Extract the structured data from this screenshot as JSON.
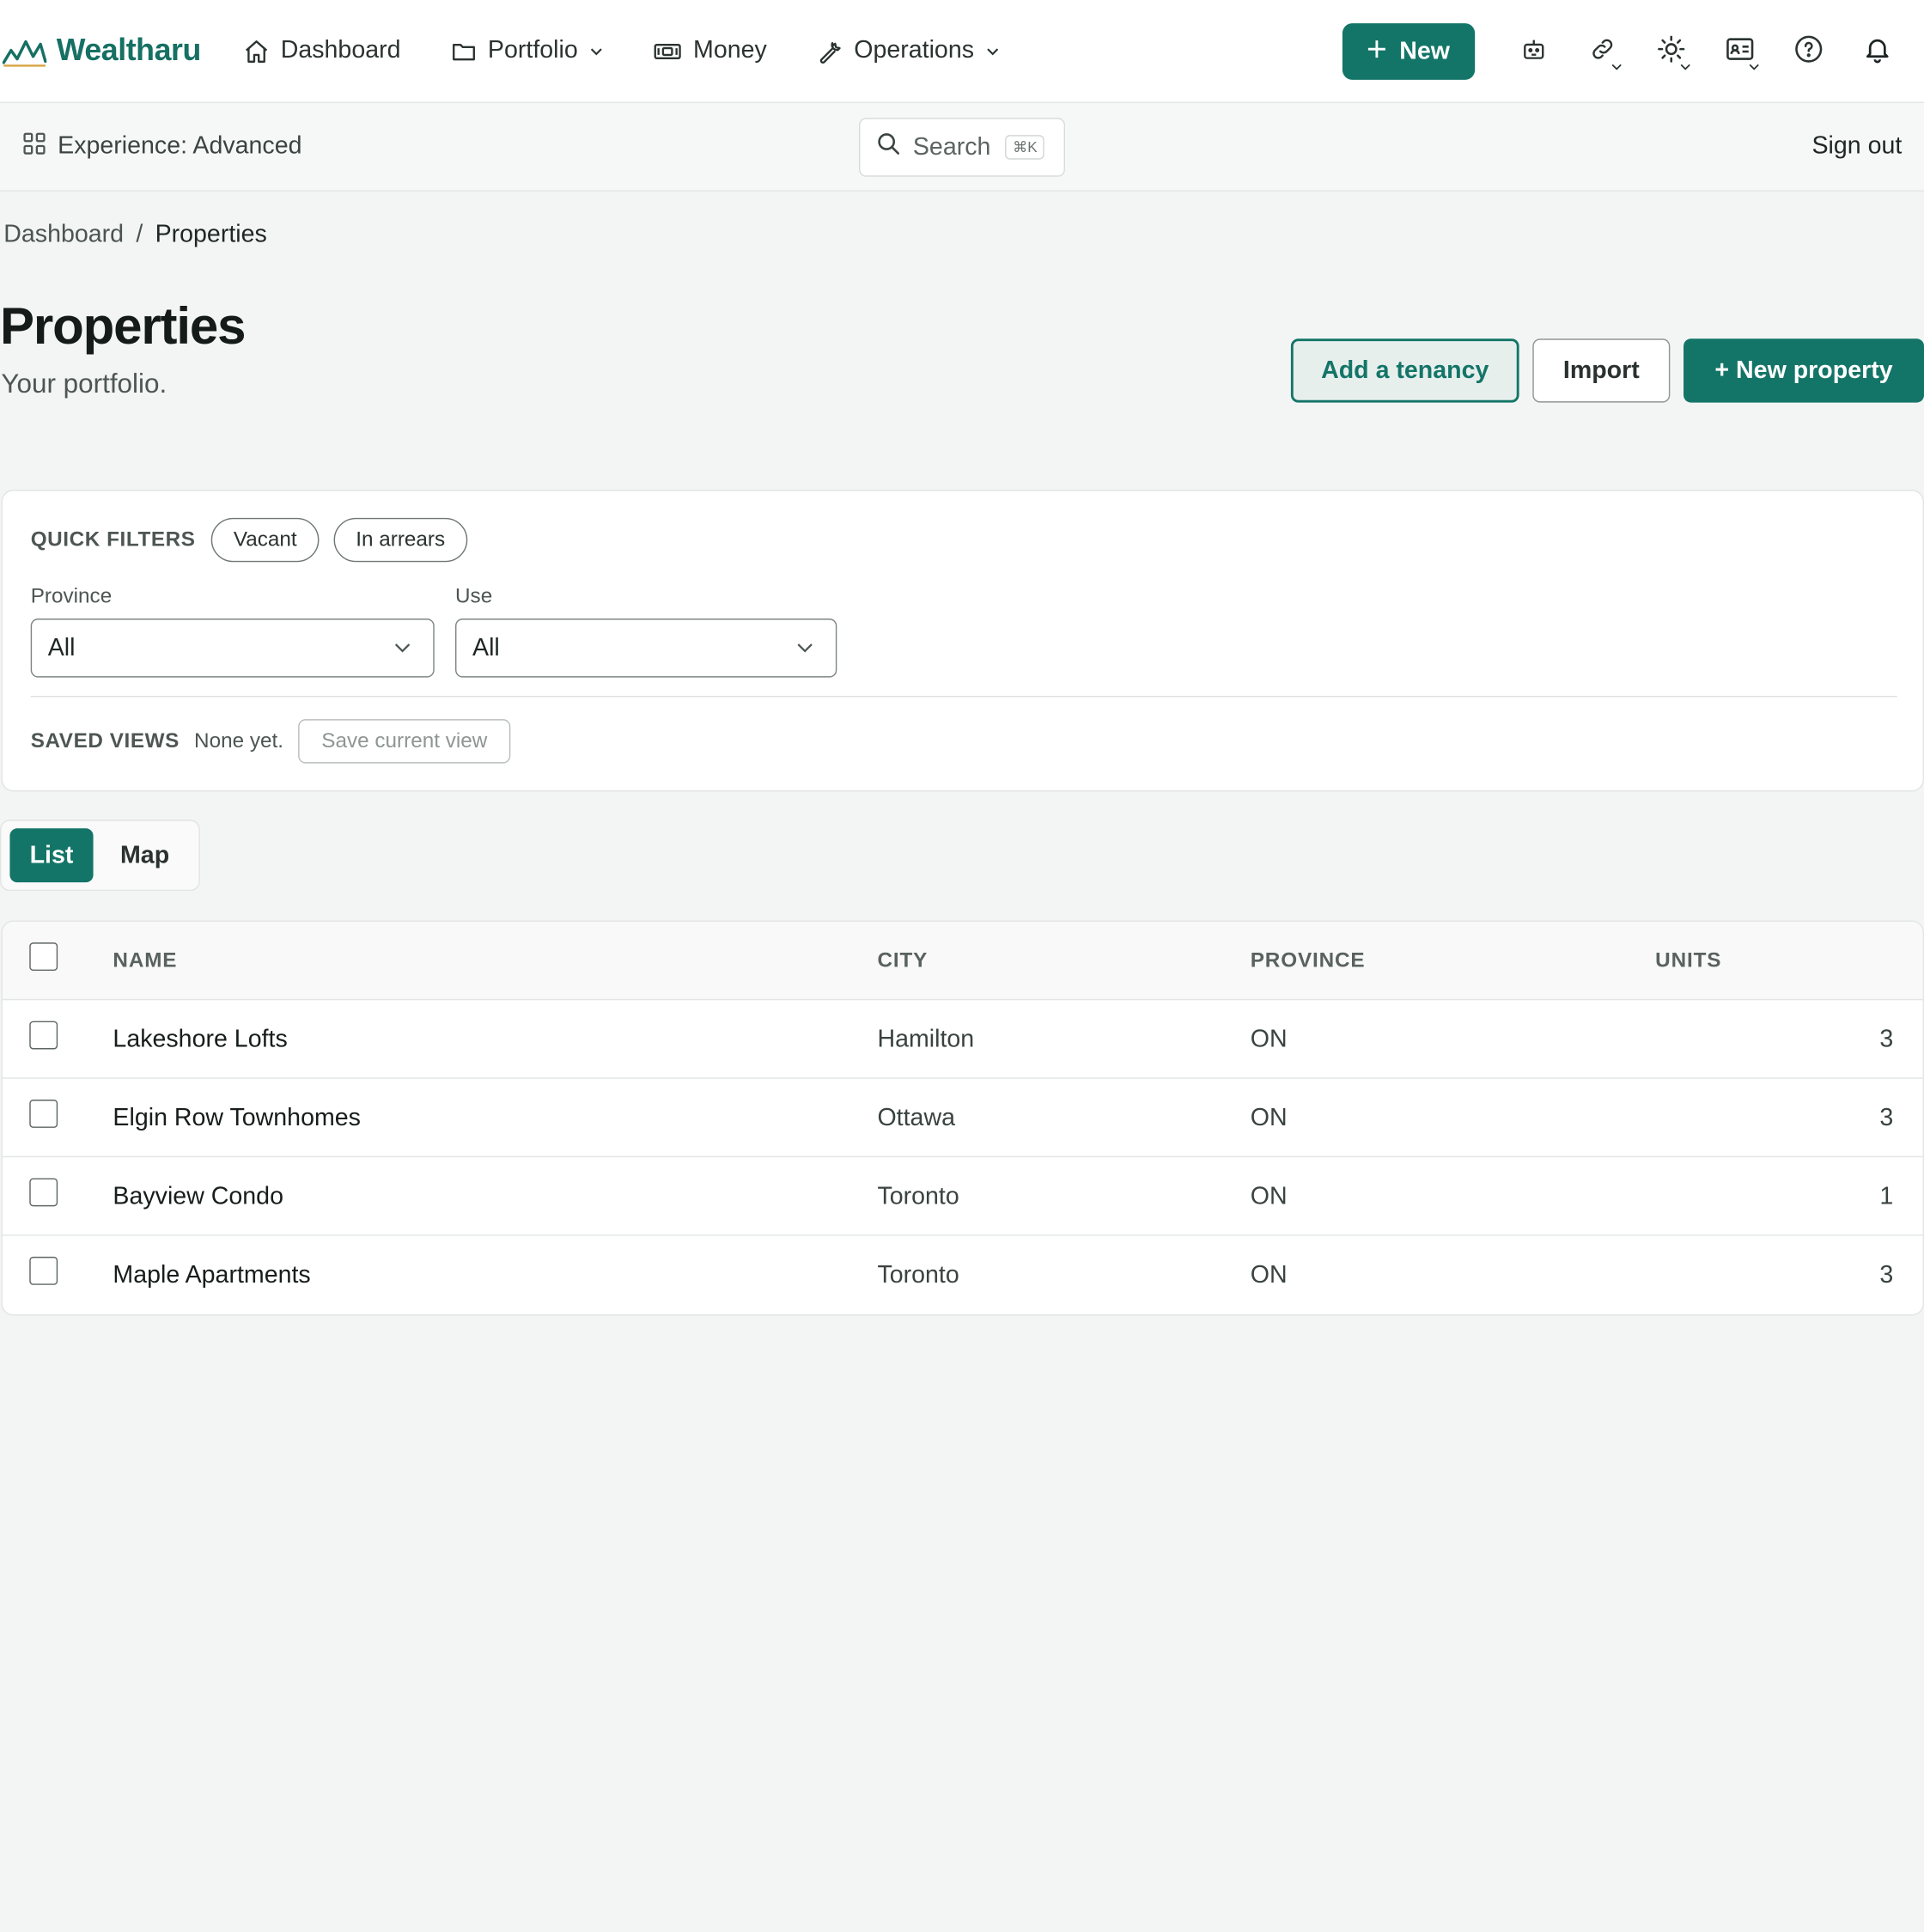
{
  "brand": {
    "name": "Wealtharu",
    "accent": "#137567"
  },
  "nav": {
    "items": [
      {
        "label": "Dashboard",
        "icon": "home-icon"
      },
      {
        "label": "Portfolio",
        "icon": "folder-icon"
      },
      {
        "label": "Money",
        "icon": "banknote-icon"
      },
      {
        "label": "Operations",
        "icon": "wrench-icon"
      }
    ],
    "new_label": "New",
    "icons": [
      "robot-icon",
      "link-icon",
      "sun-icon",
      "id-card-icon",
      "help-icon",
      "bell-icon"
    ]
  },
  "subbar": {
    "experience": "Experience: Advanced",
    "search_label": "Search",
    "search_shortcut": "⌘K",
    "signout": "Sign out"
  },
  "breadcrumb": {
    "root": "Dashboard",
    "separator": "/",
    "current": "Properties"
  },
  "header": {
    "title": "Properties",
    "subtitle": "Your portfolio.",
    "actions": {
      "add_tenancy": "Add a tenancy",
      "import": "Import",
      "new_property": "+ New property"
    }
  },
  "filters": {
    "quick_label": "QUICK FILTERS",
    "quick": [
      "Vacant",
      "In arrears"
    ],
    "province_label": "Province",
    "province_value": "All",
    "use_label": "Use",
    "use_value": "All",
    "saved_label": "SAVED VIEWS",
    "saved_none": "None yet.",
    "save_view": "Save current view"
  },
  "view_toggle": {
    "list": "List",
    "map": "Map",
    "active": "List"
  },
  "table": {
    "columns": {
      "name": "NAME",
      "city": "CITY",
      "province": "PROVINCE",
      "units": "UNITS"
    },
    "rows": [
      {
        "name": "Lakeshore Lofts",
        "city": "Hamilton",
        "province": "ON",
        "units": "3"
      },
      {
        "name": "Elgin Row Townhomes",
        "city": "Ottawa",
        "province": "ON",
        "units": "3"
      },
      {
        "name": "Bayview Condo",
        "city": "Toronto",
        "province": "ON",
        "units": "1"
      },
      {
        "name": "Maple Apartments",
        "city": "Toronto",
        "province": "ON",
        "units": "3"
      }
    ]
  }
}
